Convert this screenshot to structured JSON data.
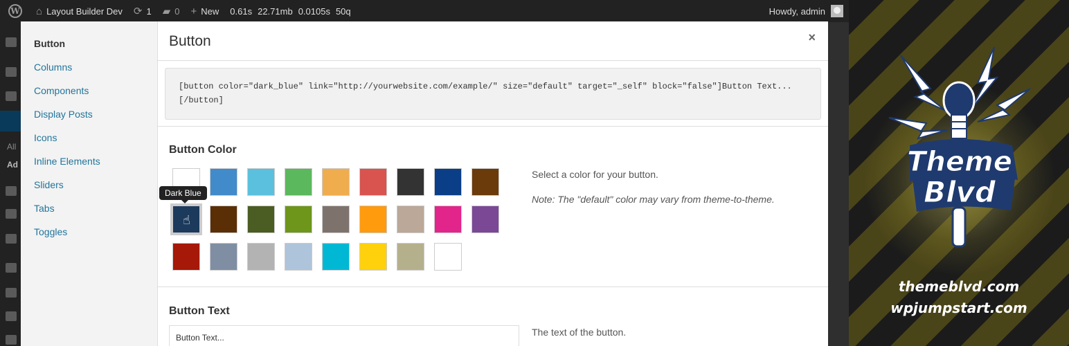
{
  "adminbar": {
    "site_name": "Layout Builder Dev",
    "updates": "1",
    "comments": "0",
    "new_label": "New",
    "metrics": [
      "0.61s",
      "22.71mb",
      "0.0105s",
      "50q"
    ],
    "howdy": "Howdy, admin"
  },
  "adminmenu": {
    "text_all": "All",
    "text_ad": "Ad"
  },
  "modal": {
    "title": "Button",
    "close_glyph": "×",
    "nav": [
      "Button",
      "Columns",
      "Components",
      "Display Posts",
      "Icons",
      "Inline Elements",
      "Sliders",
      "Tabs",
      "Toggles"
    ],
    "shortcode": "[button color=\"dark_blue\" link=\"http://yourwebsite.com/example/\" size=\"default\" target=\"_self\" block=\"false\"]Button Text... [/button]",
    "color_section": {
      "label": "Button Color",
      "tooltip": "Dark Blue",
      "help": "Select a color for your button.",
      "note": "Note: The \"default\" color may vary from theme-to-theme.",
      "swatches": [
        [
          "#ffffff",
          "#428bca",
          "#5bc0de",
          "#5cb85c",
          "#f0ad4e",
          "#d9534f",
          "#333333",
          "#0a3f87",
          "#6b3b0b"
        ],
        [
          "#1c3a5c",
          "#5a2f06",
          "#4b5d23",
          "#6e961b",
          "#7e736c",
          "#ff9b0d",
          "#bba898",
          "#e2258a",
          "#7b4896"
        ],
        [
          "#a61807",
          "#7f8ea3",
          "#b3b3b3",
          "#aec4db",
          "#00b8d4",
          "#ffd10c",
          "#b5b08c",
          "#ffffff"
        ]
      ],
      "selected": "Dark Blue"
    },
    "text_section": {
      "label": "Button Text",
      "value": "Button Text...",
      "help": "The text of the button."
    }
  },
  "brand": {
    "logo_line1": "Theme",
    "logo_line2": "Blvd",
    "site1": "themeblvd.com",
    "site2": "wpjumpstart.com"
  }
}
